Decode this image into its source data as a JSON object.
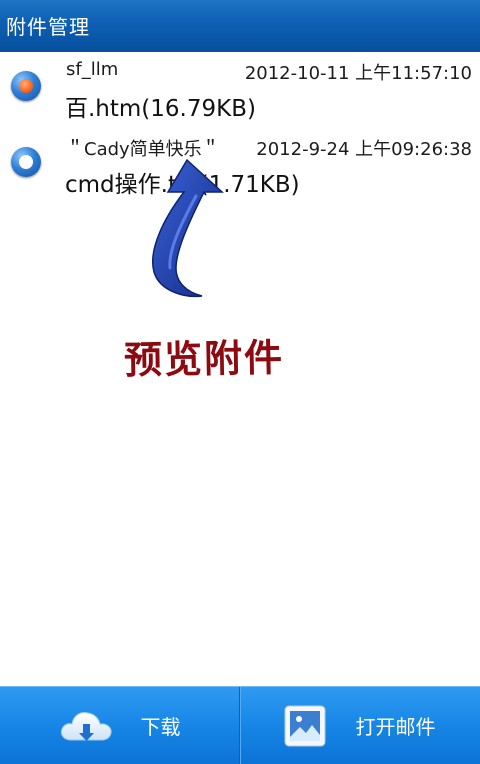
{
  "header": {
    "title": "附件管理"
  },
  "attachments": [
    {
      "sender": "sf_llm",
      "date": "2012-10-11 上午11:57:10",
      "filename": "百.htm(16.79KB)",
      "selected": true
    },
    {
      "sender": "＂Cady简单快乐＂",
      "date": "2012-9-24 上午09:26:38",
      "filename": "cmd操作.txt(1.71KB)",
      "selected": false
    }
  ],
  "annotation": {
    "text": "预览附件"
  },
  "toolbar": {
    "download_label": "下载",
    "download_icon": "cloud-download-icon",
    "open_mail_label": "打开邮件",
    "open_mail_icon": "picture-icon"
  },
  "colors": {
    "title_bar": "#0d5fb4",
    "bottom_bar": "#1786e6",
    "selected_radio": "#ff6a20",
    "annotation_text": "#8c0a10",
    "arrow": "#1e3aa0"
  }
}
